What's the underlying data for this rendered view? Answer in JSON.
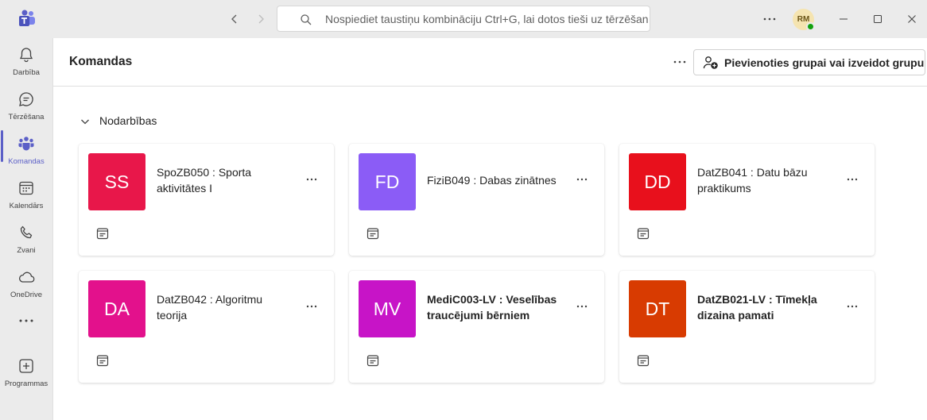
{
  "titlebar": {
    "app_icon": "teams-logo-icon",
    "search_placeholder": "Nospiediet taustiņu kombināciju Ctrl+G, lai dotos tieši uz tērzēšan",
    "avatar_initials": "RM",
    "presence_color": "#13a10e"
  },
  "rail": {
    "items": [
      {
        "label": "Darbība",
        "icon": "bell-icon"
      },
      {
        "label": "Tērzēšana",
        "icon": "chat-icon"
      },
      {
        "label": "Komandas",
        "icon": "teams-icon",
        "active": true
      },
      {
        "label": "Kalendārs",
        "icon": "calendar-icon"
      },
      {
        "label": "Zvani",
        "icon": "phone-icon"
      },
      {
        "label": "OneDrive",
        "icon": "cloud-icon"
      },
      {
        "label": "Programmas",
        "icon": "add-apps-icon"
      }
    ],
    "accent": "#5b5fc7"
  },
  "header": {
    "title": "Komandas",
    "join_button_label": "Pievienoties grupai vai izveidot grupu"
  },
  "section": {
    "title": "Nodarbības"
  },
  "teams": [
    {
      "initials": "SS",
      "name": "SpoZB050 : Sporta aktivitātes I",
      "color": "#e8174a",
      "bold": false
    },
    {
      "initials": "FD",
      "name": "FiziB049 : Dabas zinātnes",
      "color": "#8b5cf6",
      "bold": false
    },
    {
      "initials": "DD",
      "name": "DatZB041 : Datu bāzu praktikums",
      "color": "#e8101c",
      "bold": false
    },
    {
      "initials": "DA",
      "name": "DatZB042 : Algoritmu teorija",
      "color": "#e3118c",
      "bold": false
    },
    {
      "initials": "MV",
      "name": "MediC003-LV : Veselības traucējumi bērniem",
      "color": "#c714c7",
      "bold": true
    },
    {
      "initials": "DT",
      "name": "DatZB021-LV : Tīmekļa dizaina pamati",
      "color": "#d83b01",
      "bold": true
    }
  ]
}
